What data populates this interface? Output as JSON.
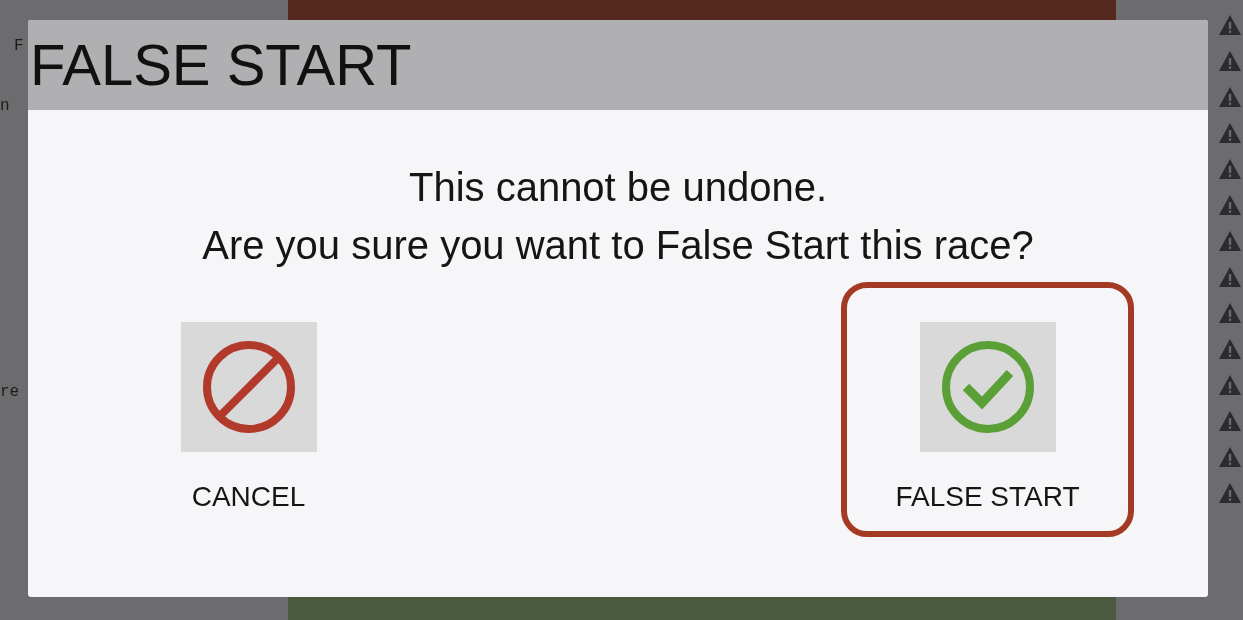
{
  "background": {
    "side_labels": [
      "F",
      "n",
      "re"
    ]
  },
  "dialog": {
    "title": "FALSE START",
    "message": [
      "This cannot be undone.",
      "Are you sure you want to False Start this race?"
    ],
    "buttons": [
      {
        "label": "CANCEL",
        "kind": "cancel",
        "selected": false
      },
      {
        "label": "FALSE START",
        "kind": "confirm",
        "selected": true
      }
    ]
  }
}
